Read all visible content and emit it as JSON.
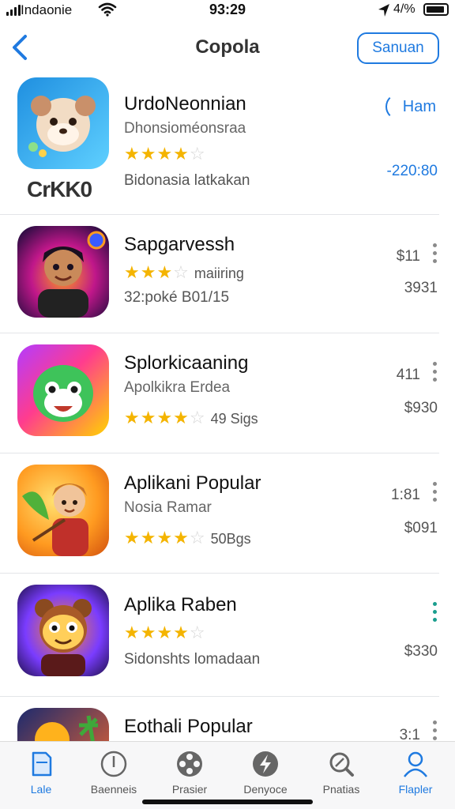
{
  "status_bar": {
    "carrier": "Indaonie",
    "time": "93:29",
    "battery": "4/%"
  },
  "nav": {
    "back_icon": "chevron-left-icon",
    "title": "Copola",
    "action_label": "Sanuan"
  },
  "apps": [
    {
      "name": "UrdoNeonnian",
      "subtitle": "Dhonsioméonsraa",
      "rating": 4,
      "rating_text": "",
      "meta": "Bidonasia latkakan",
      "brand": "CrKK0",
      "side_top": "Ham",
      "side_bottom": "-220:80",
      "icon_colors": [
        "#2aa7e8",
        "#4cc3f5"
      ]
    },
    {
      "name": "Sapgarvessh",
      "subtitle": "",
      "rating": 3,
      "rating_text": "maiiring",
      "meta": "32:poké B01/15",
      "side_top": "$11",
      "side_bottom": "3931",
      "icon_colors": [
        "#1a0b3a",
        "#ff5f1f"
      ]
    },
    {
      "name": "Splorkicaaning",
      "subtitle": "Apolkikra Erdea",
      "rating": 4,
      "rating_text": "49 Sigs",
      "meta": "",
      "side_top": "411",
      "side_bottom": "$930",
      "icon_colors": [
        "#ff3c8e",
        "#ffd400"
      ]
    },
    {
      "name": "Aplikani Popular",
      "subtitle": "Nosia Ramar",
      "rating": 4,
      "rating_text": "50Bgs",
      "meta": "",
      "side_top": "1:81",
      "side_bottom": "$091",
      "icon_colors": [
        "#ffb020",
        "#6fc23a"
      ]
    },
    {
      "name": "Aplika Raben",
      "subtitle": "",
      "rating": 4,
      "rating_text": "",
      "meta": "Sidonshts lomadaan",
      "side_top": "",
      "side_bottom": "$330",
      "icon_colors": [
        "#1d1340",
        "#7a3cff"
      ]
    },
    {
      "name": "Eothali Popular",
      "subtitle": "",
      "rating": 0,
      "rating_text": "",
      "meta": "",
      "side_top": "3:1",
      "side_bottom": "",
      "icon_colors": [
        "#1c2a6e",
        "#ffb21c"
      ]
    }
  ],
  "tabs": [
    {
      "label": "Lale",
      "icon": "document-icon",
      "active": true
    },
    {
      "label": "Baenneis",
      "icon": "clock-icon",
      "active": false
    },
    {
      "label": "Prasier",
      "icon": "film-reel-icon",
      "active": false
    },
    {
      "label": "Denyoce",
      "icon": "bolt-icon",
      "active": false
    },
    {
      "label": "Pnatias",
      "icon": "search-icon",
      "active": false
    },
    {
      "label": "Flapler",
      "icon": "person-icon",
      "active": true
    }
  ],
  "colors": {
    "accent": "#1f7ae0",
    "star": "#f4b400",
    "kebab_teal": "#1a9e8e"
  }
}
